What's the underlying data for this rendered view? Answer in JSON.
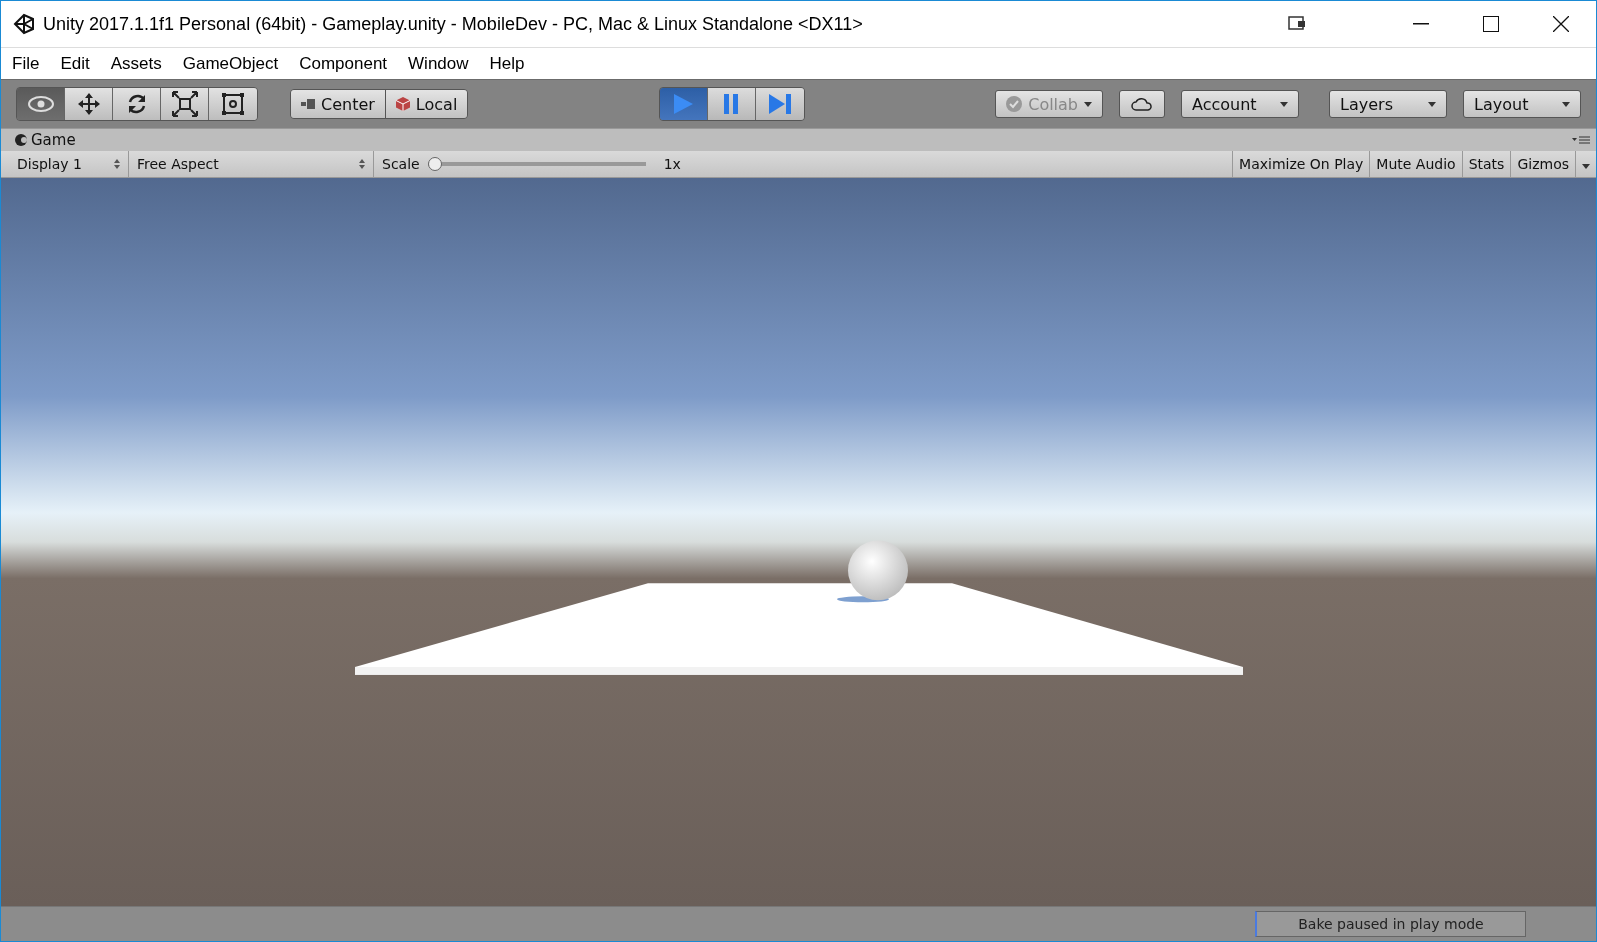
{
  "window": {
    "title": "Unity 2017.1.1f1 Personal (64bit) - Gameplay.unity - MobileDev - PC, Mac & Linux Standalone <DX11>"
  },
  "menu": [
    "File",
    "Edit",
    "Assets",
    "GameObject",
    "Component",
    "Window",
    "Help"
  ],
  "tools": [
    {
      "kind": "view",
      "selected": true
    },
    {
      "kind": "move",
      "selected": false
    },
    {
      "kind": "rotate",
      "selected": false
    },
    {
      "kind": "scale",
      "selected": false
    },
    {
      "kind": "rect",
      "selected": false
    }
  ],
  "pivot": [
    {
      "kind": "center",
      "label": "Center"
    },
    {
      "kind": "local",
      "label": "Local"
    }
  ],
  "play": [
    {
      "kind": "play",
      "selected": true
    },
    {
      "kind": "pause",
      "selected": false
    },
    {
      "kind": "step",
      "selected": false
    }
  ],
  "right_buttons": [
    {
      "kind": "collab",
      "label": "Collab",
      "disabled": true
    },
    {
      "kind": "cloud"
    },
    {
      "kind": "dropdown",
      "label": "Account"
    },
    {
      "kind": "dropdown",
      "label": "Layers"
    },
    {
      "kind": "dropdown",
      "label": "Layout"
    }
  ],
  "game_tab": {
    "title": "Game"
  },
  "game_toolbar": {
    "display": "Display 1",
    "aspect": "Free Aspect",
    "scale_label": "Scale",
    "scale": {
      "level": 0.0
    },
    "scale_reading": "1x",
    "toggles": [
      {
        "label": "Maximize On Play",
        "on": false
      },
      {
        "label": "Mute Audio",
        "on": false
      },
      {
        "label": "Stats",
        "on": false
      },
      {
        "label": "Gizmos",
        "on": false
      }
    ]
  },
  "status_bar": {
    "message": "Bake paused in play mode"
  }
}
